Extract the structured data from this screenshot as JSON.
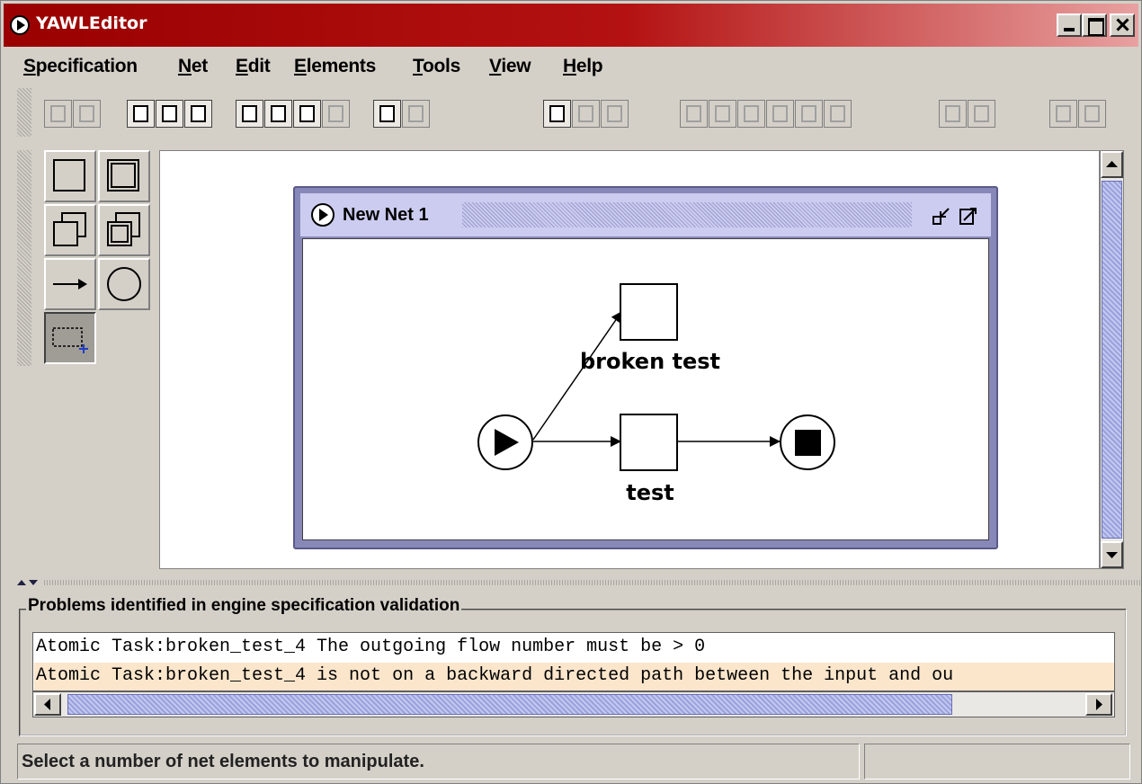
{
  "window": {
    "title": "YAWLEditor"
  },
  "menu": [
    "Specification",
    "Net",
    "Edit",
    "Elements",
    "Tools",
    "View",
    "Help"
  ],
  "toolbar": {
    "groups": [
      [
        "new-spec",
        "open-spec",
        "save-spec",
        "save-spec-as",
        "close-spec"
      ],
      [
        "validate",
        "analyse",
        "export",
        "import"
      ],
      [
        "new-net",
        "delete-net"
      ],
      [
        "undo",
        "redo",
        "delete"
      ],
      [
        "align-top",
        "align-middle",
        "align-bottom",
        "align-left",
        "align-center",
        "align-right"
      ],
      [
        "increase-size",
        "decrease-size"
      ],
      [
        "add-to-cancellation-set",
        "remove-from-cancellation-set"
      ]
    ]
  },
  "palette": {
    "tools": [
      "atomic-task",
      "multiple-atomic-task",
      "composite-task",
      "multiple-composite-task",
      "flow",
      "condition",
      "marquee-select"
    ],
    "selected": "marquee-select"
  },
  "net": {
    "title": "New Net 1",
    "tasks": [
      {
        "id": "broken-test",
        "label": "broken test"
      },
      {
        "id": "test",
        "label": "test"
      }
    ],
    "conditions": [
      {
        "id": "input-condition",
        "kind": "input"
      },
      {
        "id": "output-condition",
        "kind": "output"
      }
    ],
    "flows": [
      {
        "from": "input-condition",
        "to": "broken-test"
      },
      {
        "from": "input-condition",
        "to": "test"
      },
      {
        "from": "test",
        "to": "output-condition"
      }
    ]
  },
  "problems": {
    "title": "Problems identified in engine specification validation",
    "items": [
      "Atomic Task:broken_test_4 The outgoing flow number must be > 0",
      "Atomic Task:broken_test_4 is not on a backward directed path between the input and ou"
    ]
  },
  "status": {
    "message": "Select a number of net elements to manipulate.",
    "secondary": ""
  }
}
